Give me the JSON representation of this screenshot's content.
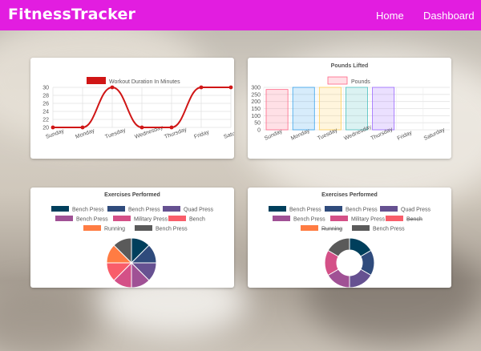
{
  "nav": {
    "brand": "FitnessTracker",
    "links": [
      {
        "label": "Home"
      },
      {
        "label": "Dashboard"
      }
    ]
  },
  "colors": {
    "nav": "#e21de0",
    "line": "#d01616"
  },
  "chart_data": [
    {
      "type": "line",
      "title": "",
      "legend": [
        "Workout Duration In Minutes"
      ],
      "categories": [
        "Sunday",
        "Monday",
        "Tuesday",
        "Wednesday",
        "Thursday",
        "Friday",
        "Saturday"
      ],
      "series": [
        {
          "name": "Workout Duration In Minutes",
          "values": [
            20,
            20,
            30,
            20,
            20,
            30,
            30
          ]
        }
      ],
      "yticks": [
        20,
        22,
        24,
        26,
        28,
        30
      ],
      "ylim": [
        20,
        30
      ],
      "grid": true,
      "legend_position": "top"
    },
    {
      "type": "bar",
      "title": "Pounds Lifted",
      "legend": [
        "Pounds"
      ],
      "categories": [
        "Sunday",
        "Monday",
        "Tuesday",
        "Wednesday",
        "Thursday",
        "Friday",
        "Saturday"
      ],
      "series": [
        {
          "name": "Pounds",
          "values": [
            285,
            300,
            300,
            300,
            300,
            0,
            0
          ]
        }
      ],
      "bar_colors": [
        "#ff6384",
        "#36a2eb",
        "#ffce56",
        "#4bc0c0",
        "#9966ff",
        "#ff9f40",
        "#c9cbcf"
      ],
      "yticks": [
        0,
        50,
        100,
        150,
        200,
        250,
        300
      ],
      "ylim": [
        0,
        300
      ],
      "grid": true,
      "legend_position": "top"
    },
    {
      "type": "pie",
      "title": "Exercises Performed",
      "legend": [
        {
          "label": "Bench Press",
          "color": "#003f5c",
          "hidden": false
        },
        {
          "label": "Bench Press",
          "color": "#2f4b7c",
          "hidden": false
        },
        {
          "label": "Quad Press",
          "color": "#665191",
          "hidden": false
        },
        {
          "label": "Bench Press",
          "color": "#a05195",
          "hidden": false
        },
        {
          "label": "Military Press",
          "color": "#d45087",
          "hidden": false
        },
        {
          "label": "Bench",
          "color": "#f95d6a",
          "hidden": false
        },
        {
          "label": "Running",
          "color": "#ff7c43",
          "hidden": false
        },
        {
          "label": "Bench Press",
          "color": "#5a5a5a",
          "hidden": false
        }
      ],
      "values": [
        1,
        1,
        1,
        1,
        1,
        1,
        1,
        1
      ],
      "legend_position": "top"
    },
    {
      "type": "doughnut",
      "title": "Exercises Performed",
      "legend": [
        {
          "label": "Bench Press",
          "color": "#003f5c",
          "hidden": false
        },
        {
          "label": "Bench Press",
          "color": "#2f4b7c",
          "hidden": false
        },
        {
          "label": "Quad Press",
          "color": "#665191",
          "hidden": false
        },
        {
          "label": "Bench Press",
          "color": "#a05195",
          "hidden": false
        },
        {
          "label": "Military Press",
          "color": "#d45087",
          "hidden": false
        },
        {
          "label": "Bench",
          "color": "#f95d6a",
          "hidden": true
        },
        {
          "label": "Running",
          "color": "#ff7c43",
          "hidden": true
        },
        {
          "label": "Bench Press",
          "color": "#5a5a5a",
          "hidden": false
        }
      ],
      "values": [
        1,
        1,
        1,
        1,
        1,
        1,
        1,
        1
      ],
      "legend_position": "top"
    }
  ]
}
